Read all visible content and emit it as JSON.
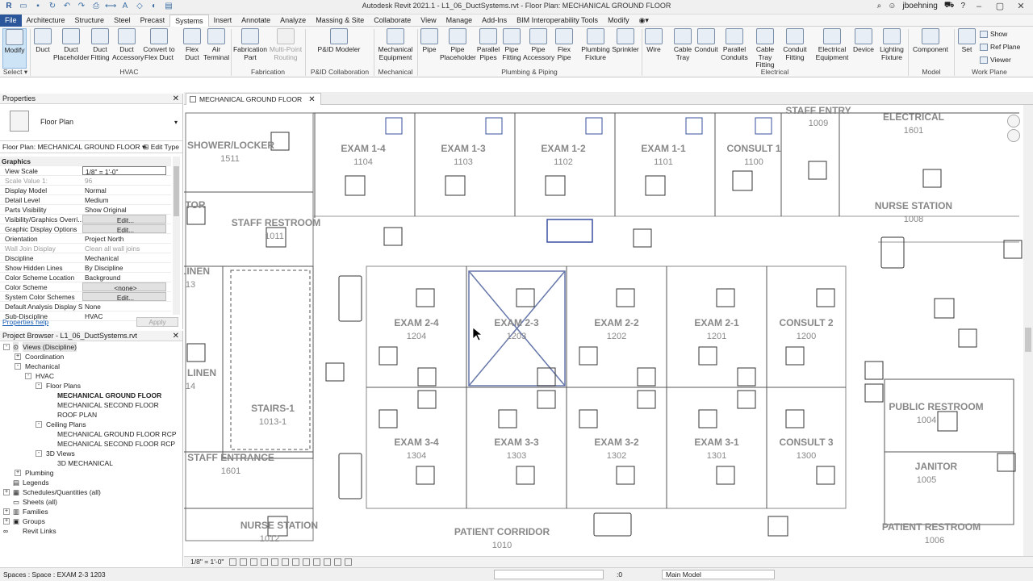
{
  "app_title": "Autodesk Revit 2021.1 - L1_06_DuctSystems.rvt - Floor Plan: MECHANICAL GROUND FLOOR",
  "user": "jboehning",
  "ribbon_tabs": [
    "File",
    "Architecture",
    "Structure",
    "Steel",
    "Precast",
    "Systems",
    "Insert",
    "Annotate",
    "Analyze",
    "Massing & Site",
    "Collaborate",
    "View",
    "Manage",
    "Add-Ins",
    "BIM Interoperability Tools",
    "Modify"
  ],
  "ribbon": {
    "modify": "Modify",
    "select": "Select",
    "hvac": {
      "duct": "Duct",
      "duct_placeholder": "Duct Placeholder",
      "duct_fitting": "Duct Fitting",
      "duct_accessory": "Duct Accessory",
      "convert": "Convert to Flex Duct",
      "flex_duct": "Flex Duct",
      "air_terminal": "Air Terminal",
      "label": "HVAC"
    },
    "fabrication": {
      "part": "Fabrication Part",
      "multipoint": "Multi-Point Routing",
      "label": "Fabrication"
    },
    "pid": {
      "modeler": "P&ID Modeler",
      "label": "P&ID Collaboration"
    },
    "mechanical": {
      "equipment": "Mechanical Equipment",
      "label": "Mechanical"
    },
    "plumbing": {
      "pipe": "Pipe",
      "pipe_placeholder": "Pipe Placeholder",
      "parallel_pipes": "Parallel Pipes",
      "pipe_fitting": "Pipe Fitting",
      "pipe_accessory": "Pipe Accessory",
      "flex_pipe": "Flex Pipe",
      "plumbing_fixture": "Plumbing Fixture",
      "sprinkler": "Sprinkler",
      "label": "Plumbing & Piping"
    },
    "electrical": {
      "wire": "Wire",
      "cable_tray": "Cable Tray",
      "conduit": "Conduit",
      "parallel_conduits": "Parallel Conduits",
      "cable_tray_fitting": "Cable Tray Fitting",
      "conduit_fitting": "Conduit Fitting",
      "electrical_equipment": "Electrical Equipment",
      "device": "Device",
      "lighting_fixture": "Lighting Fixture",
      "label": "Electrical"
    },
    "model": {
      "component": "Component",
      "label": "Model"
    },
    "workplane": {
      "set": "Set",
      "show": "Show",
      "ref_plane": "Ref Plane",
      "viewer": "Viewer",
      "label": "Work Plane"
    }
  },
  "properties": {
    "title": "Properties",
    "type_name": "Floor Plan",
    "instance": "Floor Plan: MECHANICAL GROUND FLOOR",
    "edit_type": "Edit Type",
    "group": "Graphics",
    "rows": [
      {
        "k": "View Scale",
        "v": "1/8\" = 1'-0\""
      },
      {
        "k": "Scale Value    1:",
        "v": "96"
      },
      {
        "k": "Display Model",
        "v": "Normal"
      },
      {
        "k": "Detail Level",
        "v": "Medium"
      },
      {
        "k": "Parts Visibility",
        "v": "Show Original"
      },
      {
        "k": "Visibility/Graphics Overri...",
        "v": "Edit..."
      },
      {
        "k": "Graphic Display Options",
        "v": "Edit..."
      },
      {
        "k": "Orientation",
        "v": "Project North"
      },
      {
        "k": "Wall Join Display",
        "v": "Clean all wall joins"
      },
      {
        "k": "Discipline",
        "v": "Mechanical"
      },
      {
        "k": "Show Hidden Lines",
        "v": "By Discipline"
      },
      {
        "k": "Color Scheme Location",
        "v": "Background"
      },
      {
        "k": "Color Scheme",
        "v": "<none>"
      },
      {
        "k": "System Color Schemes",
        "v": "Edit..."
      },
      {
        "k": "Default Analysis Display S...",
        "v": "None"
      },
      {
        "k": "Sub-Discipline",
        "v": "HVAC"
      }
    ],
    "help": "Properties help",
    "apply": "Apply"
  },
  "browser": {
    "title": "Project Browser - L1_06_DuctSystems.rvt",
    "nodes": [
      {
        "label": "Views (Discipline)",
        "tog": "-"
      },
      {
        "label": "Coordination",
        "tog": "+"
      },
      {
        "label": "Mechanical",
        "tog": "-"
      },
      {
        "label": "HVAC",
        "tog": "-"
      },
      {
        "label": "Floor Plans",
        "tog": "-"
      },
      {
        "label": "MECHANICAL GROUND FLOOR",
        "tog": ""
      },
      {
        "label": "MECHANICAL SECOND FLOOR",
        "tog": ""
      },
      {
        "label": "ROOF PLAN",
        "tog": ""
      },
      {
        "label": "Ceiling Plans",
        "tog": "-"
      },
      {
        "label": "MECHANICAL GROUND FLOOR RCP",
        "tog": ""
      },
      {
        "label": "MECHANICAL SECOND FLOOR RCP",
        "tog": ""
      },
      {
        "label": "3D Views",
        "tog": "-"
      },
      {
        "label": "3D MECHANICAL",
        "tog": ""
      },
      {
        "label": "Plumbing",
        "tog": "+"
      },
      {
        "label": "Legends",
        "tog": ""
      },
      {
        "label": "Schedules/Quantities (all)",
        "tog": "+"
      },
      {
        "label": "Sheets (all)",
        "tog": ""
      },
      {
        "label": "Families",
        "tog": "+"
      },
      {
        "label": "Groups",
        "tog": "+"
      },
      {
        "label": "Revit Links",
        "tog": ""
      }
    ]
  },
  "view_tab": "MECHANICAL GROUND FLOOR",
  "rooms": [
    {
      "name": "SHOWER/LOCKER",
      "num": "1511"
    },
    {
      "name": "EXAM 1-4",
      "num": "1104"
    },
    {
      "name": "EXAM 1-3",
      "num": "1103"
    },
    {
      "name": "EXAM 1-2",
      "num": "1102"
    },
    {
      "name": "EXAM 1-1",
      "num": "1101"
    },
    {
      "name": "CONSULT 1",
      "num": "1100"
    },
    {
      "name": "STAFF ENTRY",
      "num": "1009"
    },
    {
      "name": "ELECTRICAL",
      "num": "1601"
    },
    {
      "name": "STAFF RESTROOM",
      "num": "1011"
    },
    {
      "name": "NURSE STATION",
      "num": "1008"
    },
    {
      "name": "TOR",
      "num": ""
    },
    {
      "name": "LINEN",
      "num": "13"
    },
    {
      "name": "EXAM 2-4",
      "num": "1204"
    },
    {
      "name": "EXAM 2-3",
      "num": "1203"
    },
    {
      "name": "EXAM 2-2",
      "num": "1202"
    },
    {
      "name": "EXAM 2-1",
      "num": "1201"
    },
    {
      "name": "CONSULT 2",
      "num": "1200"
    },
    {
      "name": "LINEN",
      "num": "14"
    },
    {
      "name": "STAIRS-1",
      "num": "1013-1"
    },
    {
      "name": "PUBLIC RESTROOM",
      "num": "1004"
    },
    {
      "name": "EXAM 3-4",
      "num": "1304"
    },
    {
      "name": "EXAM 3-3",
      "num": "1303"
    },
    {
      "name": "EXAM 3-2",
      "num": "1302"
    },
    {
      "name": "EXAM 3-1",
      "num": "1301"
    },
    {
      "name": "CONSULT 3",
      "num": "1300"
    },
    {
      "name": "STAFF ENTRANCE",
      "num": "1601"
    },
    {
      "name": "JANITOR",
      "num": "1005"
    },
    {
      "name": "NURSE STATION",
      "num": "1012"
    },
    {
      "name": "PATIENT CORRIDOR",
      "num": "1010"
    },
    {
      "name": "PATIENT RESTROOM",
      "num": "1006"
    }
  ],
  "view_scale": "1/8\" = 1'-0\"",
  "status": {
    "text": "Spaces : Space : EXAM 2-3 1203",
    "sel_count": ":0",
    "model": "Main Model"
  }
}
